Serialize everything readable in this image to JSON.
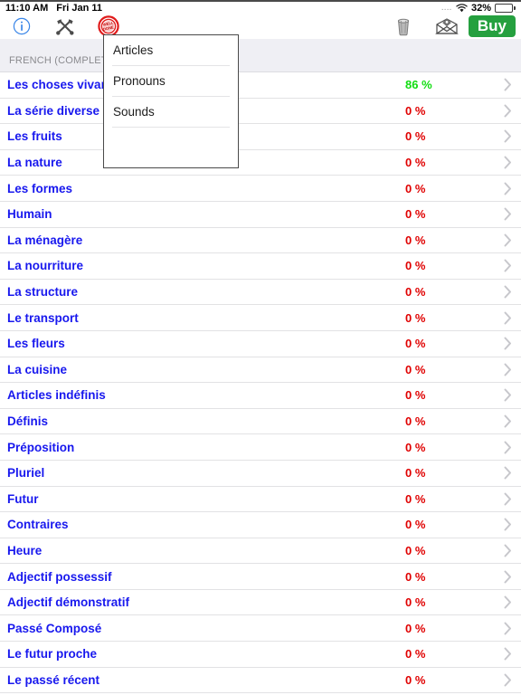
{
  "statusbar": {
    "time": "11:10 AM",
    "date": "Fri Jan 11",
    "signal_dots": "....",
    "wifi_icon": "wifi-icon",
    "battery_percent": "32%",
    "battery_level": 32
  },
  "toolbar": {
    "info_icon": "info-icon",
    "tools_icon": "tools-icon",
    "stamp_icon": "well-done-stamp-icon",
    "trash_icon": "trash-icon",
    "mail_icon": "mail-envelope-icon",
    "buy_label": "Buy"
  },
  "section": {
    "header": "FRENCH (COMPLETE)"
  },
  "popup": {
    "items": [
      {
        "label": "Articles"
      },
      {
        "label": "Pronouns"
      },
      {
        "label": "Sounds"
      },
      {
        "label": ""
      }
    ]
  },
  "colors": {
    "link_blue": "#1818ee",
    "zero_red": "#e00000",
    "progress_green": "#10dd10",
    "buy_green": "#25a03f",
    "header_gray": "#efeff4",
    "chevron_gray": "#c7c7cc"
  },
  "list": {
    "rows": [
      {
        "title": "Les choses vivantes",
        "percent": "86 %",
        "state": "green"
      },
      {
        "title": "La série diverse",
        "percent": "0 %",
        "state": "red"
      },
      {
        "title": "Les fruits",
        "percent": "0 %",
        "state": "red"
      },
      {
        "title": "La nature",
        "percent": "0 %",
        "state": "red"
      },
      {
        "title": "Les formes",
        "percent": "0 %",
        "state": "red"
      },
      {
        "title": "Humain",
        "percent": "0 %",
        "state": "red"
      },
      {
        "title": "La ménagère",
        "percent": "0 %",
        "state": "red"
      },
      {
        "title": "La nourriture",
        "percent": "0 %",
        "state": "red"
      },
      {
        "title": "La structure",
        "percent": "0 %",
        "state": "red"
      },
      {
        "title": "Le transport",
        "percent": "0 %",
        "state": "red"
      },
      {
        "title": "Les fleurs",
        "percent": "0 %",
        "state": "red"
      },
      {
        "title": "La cuisine",
        "percent": "0 %",
        "state": "red"
      },
      {
        "title": "Articles indéfinis",
        "percent": "0 %",
        "state": "red"
      },
      {
        "title": "Définis",
        "percent": "0 %",
        "state": "red"
      },
      {
        "title": "Préposition",
        "percent": "0 %",
        "state": "red"
      },
      {
        "title": "Pluriel",
        "percent": "0 %",
        "state": "red"
      },
      {
        "title": "Futur",
        "percent": "0 %",
        "state": "red"
      },
      {
        "title": "Contraires",
        "percent": "0 %",
        "state": "red"
      },
      {
        "title": "Heure",
        "percent": "0 %",
        "state": "red"
      },
      {
        "title": "Adjectif possessif",
        "percent": "0 %",
        "state": "red"
      },
      {
        "title": "Adjectif démonstratif",
        "percent": "0 %",
        "state": "red"
      },
      {
        "title": "Passé Composé",
        "percent": "0 %",
        "state": "red"
      },
      {
        "title": "Le futur proche",
        "percent": "0 %",
        "state": "red"
      },
      {
        "title": "Le passé récent",
        "percent": "0 %",
        "state": "red"
      }
    ]
  }
}
